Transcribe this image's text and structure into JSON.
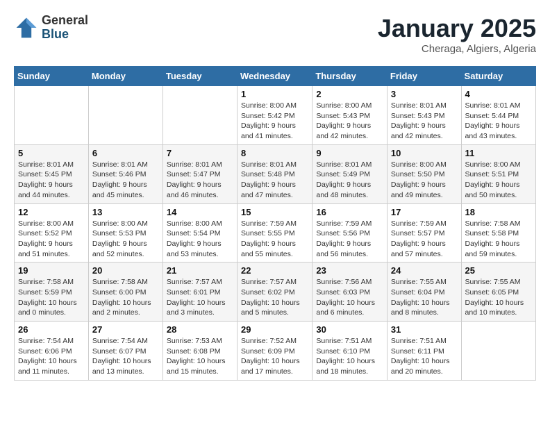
{
  "logo": {
    "general": "General",
    "blue": "Blue"
  },
  "title": "January 2025",
  "location": "Cheraga, Algiers, Algeria",
  "days_of_week": [
    "Sunday",
    "Monday",
    "Tuesday",
    "Wednesday",
    "Thursday",
    "Friday",
    "Saturday"
  ],
  "weeks": [
    [
      {
        "day": "",
        "info": ""
      },
      {
        "day": "",
        "info": ""
      },
      {
        "day": "",
        "info": ""
      },
      {
        "day": "1",
        "info": "Sunrise: 8:00 AM\nSunset: 5:42 PM\nDaylight: 9 hours\nand 41 minutes."
      },
      {
        "day": "2",
        "info": "Sunrise: 8:00 AM\nSunset: 5:43 PM\nDaylight: 9 hours\nand 42 minutes."
      },
      {
        "day": "3",
        "info": "Sunrise: 8:01 AM\nSunset: 5:43 PM\nDaylight: 9 hours\nand 42 minutes."
      },
      {
        "day": "4",
        "info": "Sunrise: 8:01 AM\nSunset: 5:44 PM\nDaylight: 9 hours\nand 43 minutes."
      }
    ],
    [
      {
        "day": "5",
        "info": "Sunrise: 8:01 AM\nSunset: 5:45 PM\nDaylight: 9 hours\nand 44 minutes."
      },
      {
        "day": "6",
        "info": "Sunrise: 8:01 AM\nSunset: 5:46 PM\nDaylight: 9 hours\nand 45 minutes."
      },
      {
        "day": "7",
        "info": "Sunrise: 8:01 AM\nSunset: 5:47 PM\nDaylight: 9 hours\nand 46 minutes."
      },
      {
        "day": "8",
        "info": "Sunrise: 8:01 AM\nSunset: 5:48 PM\nDaylight: 9 hours\nand 47 minutes."
      },
      {
        "day": "9",
        "info": "Sunrise: 8:01 AM\nSunset: 5:49 PM\nDaylight: 9 hours\nand 48 minutes."
      },
      {
        "day": "10",
        "info": "Sunrise: 8:00 AM\nSunset: 5:50 PM\nDaylight: 9 hours\nand 49 minutes."
      },
      {
        "day": "11",
        "info": "Sunrise: 8:00 AM\nSunset: 5:51 PM\nDaylight: 9 hours\nand 50 minutes."
      }
    ],
    [
      {
        "day": "12",
        "info": "Sunrise: 8:00 AM\nSunset: 5:52 PM\nDaylight: 9 hours\nand 51 minutes."
      },
      {
        "day": "13",
        "info": "Sunrise: 8:00 AM\nSunset: 5:53 PM\nDaylight: 9 hours\nand 52 minutes."
      },
      {
        "day": "14",
        "info": "Sunrise: 8:00 AM\nSunset: 5:54 PM\nDaylight: 9 hours\nand 53 minutes."
      },
      {
        "day": "15",
        "info": "Sunrise: 7:59 AM\nSunset: 5:55 PM\nDaylight: 9 hours\nand 55 minutes."
      },
      {
        "day": "16",
        "info": "Sunrise: 7:59 AM\nSunset: 5:56 PM\nDaylight: 9 hours\nand 56 minutes."
      },
      {
        "day": "17",
        "info": "Sunrise: 7:59 AM\nSunset: 5:57 PM\nDaylight: 9 hours\nand 57 minutes."
      },
      {
        "day": "18",
        "info": "Sunrise: 7:58 AM\nSunset: 5:58 PM\nDaylight: 9 hours\nand 59 minutes."
      }
    ],
    [
      {
        "day": "19",
        "info": "Sunrise: 7:58 AM\nSunset: 5:59 PM\nDaylight: 10 hours\nand 0 minutes."
      },
      {
        "day": "20",
        "info": "Sunrise: 7:58 AM\nSunset: 6:00 PM\nDaylight: 10 hours\nand 2 minutes."
      },
      {
        "day": "21",
        "info": "Sunrise: 7:57 AM\nSunset: 6:01 PM\nDaylight: 10 hours\nand 3 minutes."
      },
      {
        "day": "22",
        "info": "Sunrise: 7:57 AM\nSunset: 6:02 PM\nDaylight: 10 hours\nand 5 minutes."
      },
      {
        "day": "23",
        "info": "Sunrise: 7:56 AM\nSunset: 6:03 PM\nDaylight: 10 hours\nand 6 minutes."
      },
      {
        "day": "24",
        "info": "Sunrise: 7:55 AM\nSunset: 6:04 PM\nDaylight: 10 hours\nand 8 minutes."
      },
      {
        "day": "25",
        "info": "Sunrise: 7:55 AM\nSunset: 6:05 PM\nDaylight: 10 hours\nand 10 minutes."
      }
    ],
    [
      {
        "day": "26",
        "info": "Sunrise: 7:54 AM\nSunset: 6:06 PM\nDaylight: 10 hours\nand 11 minutes."
      },
      {
        "day": "27",
        "info": "Sunrise: 7:54 AM\nSunset: 6:07 PM\nDaylight: 10 hours\nand 13 minutes."
      },
      {
        "day": "28",
        "info": "Sunrise: 7:53 AM\nSunset: 6:08 PM\nDaylight: 10 hours\nand 15 minutes."
      },
      {
        "day": "29",
        "info": "Sunrise: 7:52 AM\nSunset: 6:09 PM\nDaylight: 10 hours\nand 17 minutes."
      },
      {
        "day": "30",
        "info": "Sunrise: 7:51 AM\nSunset: 6:10 PM\nDaylight: 10 hours\nand 18 minutes."
      },
      {
        "day": "31",
        "info": "Sunrise: 7:51 AM\nSunset: 6:11 PM\nDaylight: 10 hours\nand 20 minutes."
      },
      {
        "day": "",
        "info": ""
      }
    ]
  ]
}
